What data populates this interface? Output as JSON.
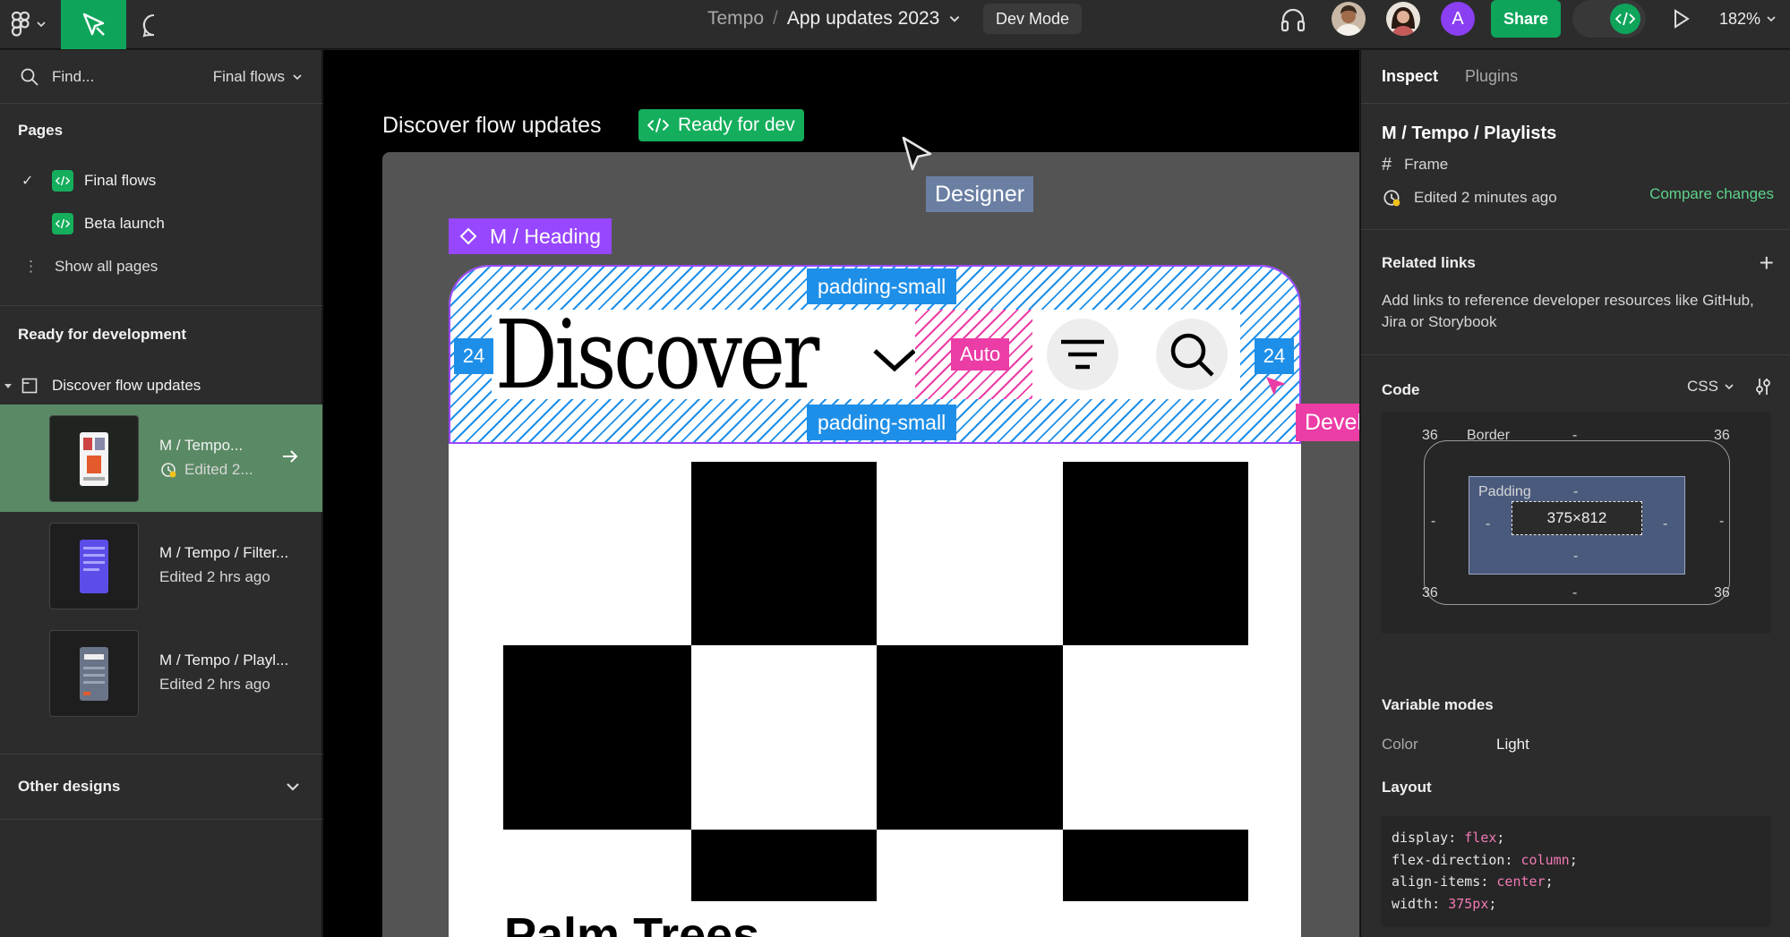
{
  "topbar": {
    "project": "Tempo",
    "separator": "/",
    "file_name": "App updates 2023",
    "dev_mode_label": "Dev Mode",
    "avatar_letter": "A",
    "share_label": "Share",
    "zoom": "182%"
  },
  "left": {
    "find_placeholder": "Find...",
    "filter_label": "Final flows",
    "pages_title": "Pages",
    "pages": [
      {
        "label": "Final flows",
        "selected": true
      },
      {
        "label": "Beta launch",
        "selected": false
      }
    ],
    "show_all": "Show all pages",
    "ready_title": "Ready for development",
    "section_item": "Discover flow updates",
    "frames": [
      {
        "title": "M / Tempo...",
        "subtitle": "Edited 2...",
        "active": true
      },
      {
        "title": "M / Tempo / Filter...",
        "subtitle": "Edited 2 hrs ago",
        "active": false
      },
      {
        "title": "M / Tempo / Playl...",
        "subtitle": "Edited 2 hrs ago",
        "active": false
      }
    ],
    "other_designs": "Other designs"
  },
  "canvas": {
    "flow_title": "Discover flow updates",
    "ready_badge": "Ready for dev",
    "designer_label": "Designer",
    "heading_label": "M / Heading",
    "padding_top_label": "padding-small",
    "padding_bottom_label": "padding-small",
    "discover_text": "Discover",
    "auto_label": "Auto",
    "left_spacing": "24",
    "right_spacing": "24",
    "developer_label": "Developer",
    "next_heading": "Palm Trees"
  },
  "right": {
    "tabs": [
      "Inspect",
      "Plugins"
    ],
    "component_title": "M / Tempo / Playlists",
    "type_label": "Frame",
    "edited": "Edited 2 minutes ago",
    "compare": "Compare changes",
    "related_title": "Related links",
    "related_desc": "Add links to reference developer resources like GitHub, Jira or Storybook",
    "code_title": "Code",
    "code_lang": "CSS",
    "box": {
      "border_label": "Border",
      "padding_label": "Padding",
      "size": "375×812",
      "corner_tl": "36",
      "corner_tr": "36",
      "corner_bl": "36",
      "corner_br": "36",
      "dash": "-"
    },
    "variable_title": "Variable modes",
    "color_label": "Color",
    "color_value": "Light",
    "layout_title": "Layout",
    "code_lines": [
      {
        "prop": "display",
        "value": "flex"
      },
      {
        "prop": "flex-direction",
        "value": "column"
      },
      {
        "prop": "align-items",
        "value": "center"
      },
      {
        "prop": "width",
        "value": "375px"
      }
    ]
  },
  "colors": {
    "green": "#0ea55b",
    "purple": "#9747ff",
    "blue": "#1e8fe8",
    "pink": "#ec3ca6"
  }
}
